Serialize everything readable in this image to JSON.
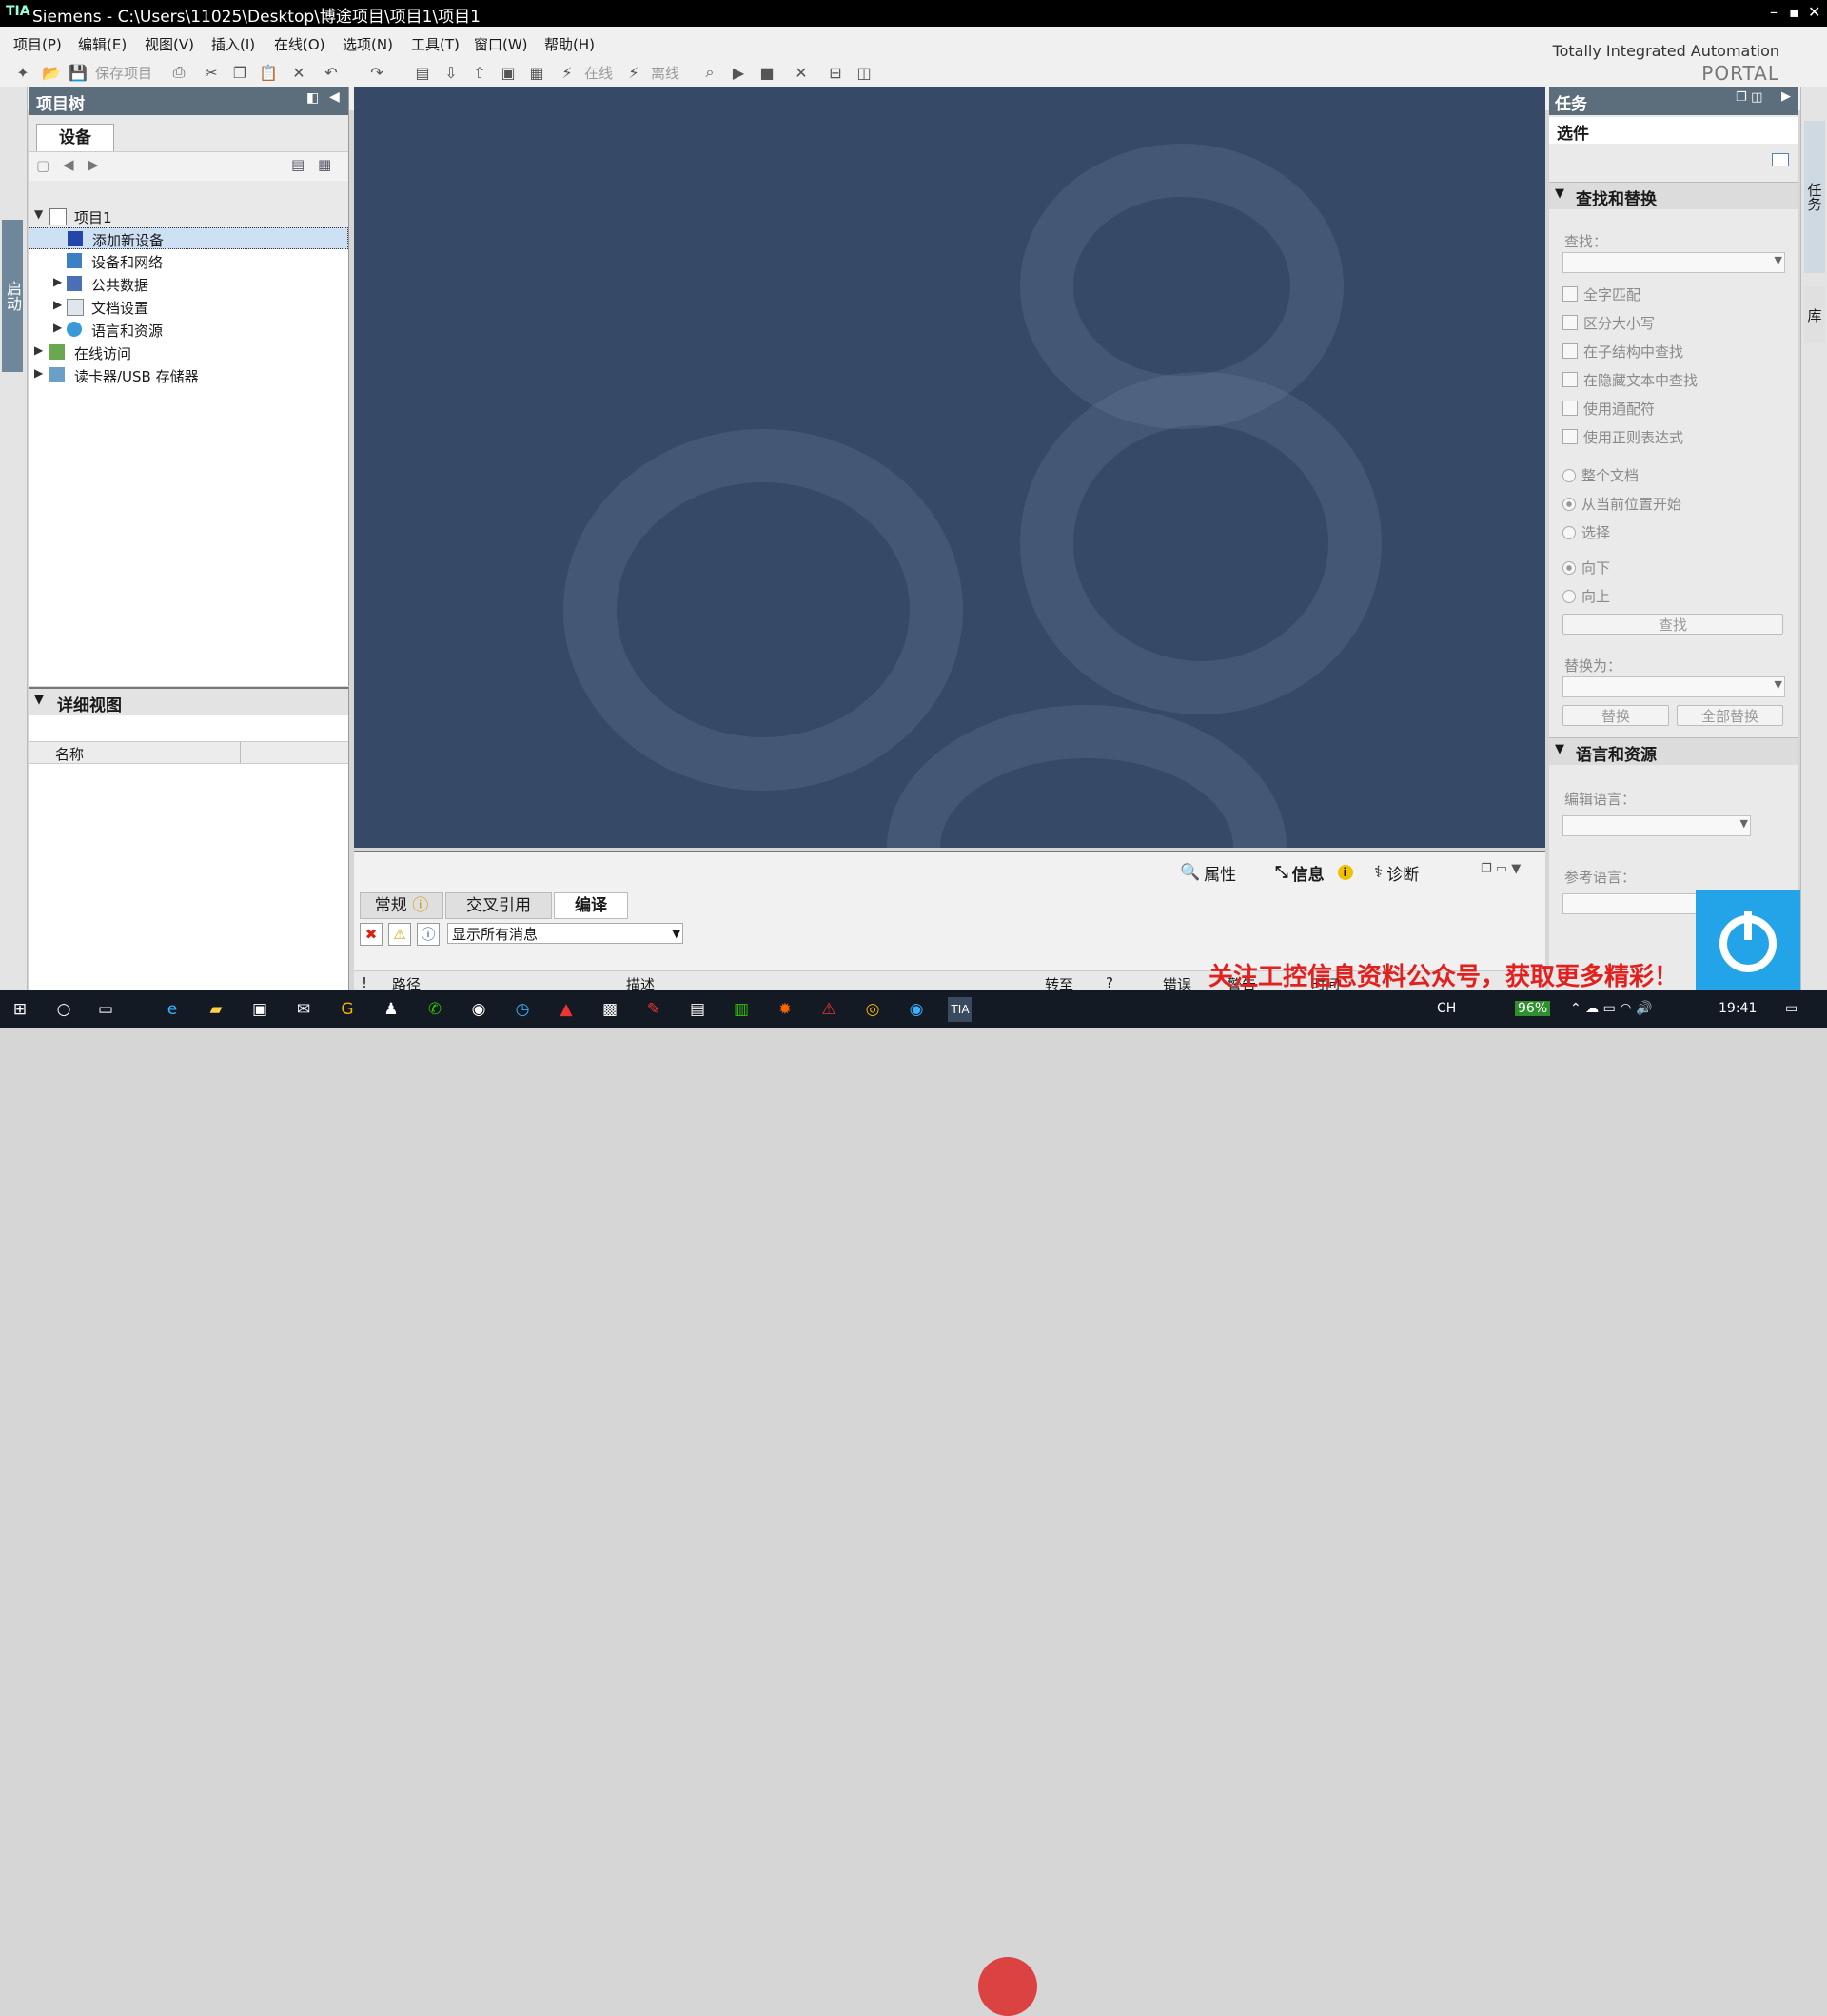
{
  "titlebar": {
    "logo": "TIA",
    "title": "Siemens  -  C:\\Users\\11025\\Desktop\\博途项目\\项目1\\项目1",
    "min": "–",
    "max": "▪",
    "close": "✕"
  },
  "menu": [
    "项目(P)",
    "编辑(E)",
    "视图(V)",
    "插入(I)",
    "在线(O)",
    "选项(N)",
    "工具(T)",
    "窗口(W)",
    "帮助(H)"
  ],
  "toolbar": {
    "save_label": "保存项目",
    "online_label": "在线",
    "offline_label": "离线"
  },
  "brand": {
    "line1": "Totally Integrated Automation",
    "line2": "PORTAL"
  },
  "left_strip": {
    "label": "启动"
  },
  "project_tree": {
    "title": "项目树",
    "tab": "设备",
    "items": [
      {
        "label": "项目1",
        "level": 0,
        "expanded": true,
        "icon": "project-icon"
      },
      {
        "label": "添加新设备",
        "level": 1,
        "selected": true,
        "icon": "add-device-icon"
      },
      {
        "label": "设备和网络",
        "level": 1,
        "icon": "network-icon"
      },
      {
        "label": "公共数据",
        "level": 1,
        "collapsed": true,
        "icon": "common-data-icon"
      },
      {
        "label": "文档设置",
        "level": 1,
        "collapsed": true,
        "icon": "document-settings-icon"
      },
      {
        "label": "语言和资源",
        "level": 1,
        "collapsed": true,
        "icon": "language-icon"
      },
      {
        "label": "在线访问",
        "level": 0,
        "collapsed": true,
        "icon": "online-access-icon"
      },
      {
        "label": "读卡器/USB 存储器",
        "level": 0,
        "collapsed": true,
        "icon": "card-reader-icon"
      }
    ]
  },
  "detail_view": {
    "title": "详细视图",
    "column_name": "名称"
  },
  "inspector": {
    "tabs": {
      "properties": "属性",
      "info": "信息",
      "diagnostics": "诊断"
    },
    "subtabs": [
      "常规",
      "交叉引用",
      "编译"
    ],
    "filter_value": "显示所有消息",
    "columns": [
      "!",
      "路径",
      "描述",
      "转至",
      "?",
      "错误",
      "警告",
      "时间"
    ]
  },
  "task_panel": {
    "title": "任务",
    "options": "选件",
    "find_replace": {
      "title": "查找和替换",
      "find_label": "查找：",
      "checkboxes": [
        "全字匹配",
        "区分大小写",
        "在子结构中查找",
        "在隐藏文本中查找",
        "使用通配符",
        "使用正则表达式"
      ],
      "scope_radios": [
        "整个文档",
        "从当前位置开始",
        "选择"
      ],
      "direction_radios": [
        "向下",
        "向上"
      ],
      "find_button": "查找",
      "replace_label": "替换为：",
      "replace_button": "替换",
      "replace_all_button": "全部替换"
    },
    "languages": {
      "title": "语言和资源",
      "edit_lang_label": "编辑语言：",
      "ref_lang_label": "参考语言："
    }
  },
  "right_strip": {
    "tasks_tab": "任务",
    "libs_tab": "库"
  },
  "taskbar": {
    "ime": "CH",
    "battery": "96%",
    "time": "19:41"
  },
  "overlay": {
    "promo": "关注工控信息资料公众号，获取更多精彩！"
  },
  "colors": {
    "panel_header": "#5c6d7c",
    "workarea": "#364a68",
    "selection": "#cde0f4",
    "promo": "#e2201d",
    "badge": "#23a3e8"
  }
}
